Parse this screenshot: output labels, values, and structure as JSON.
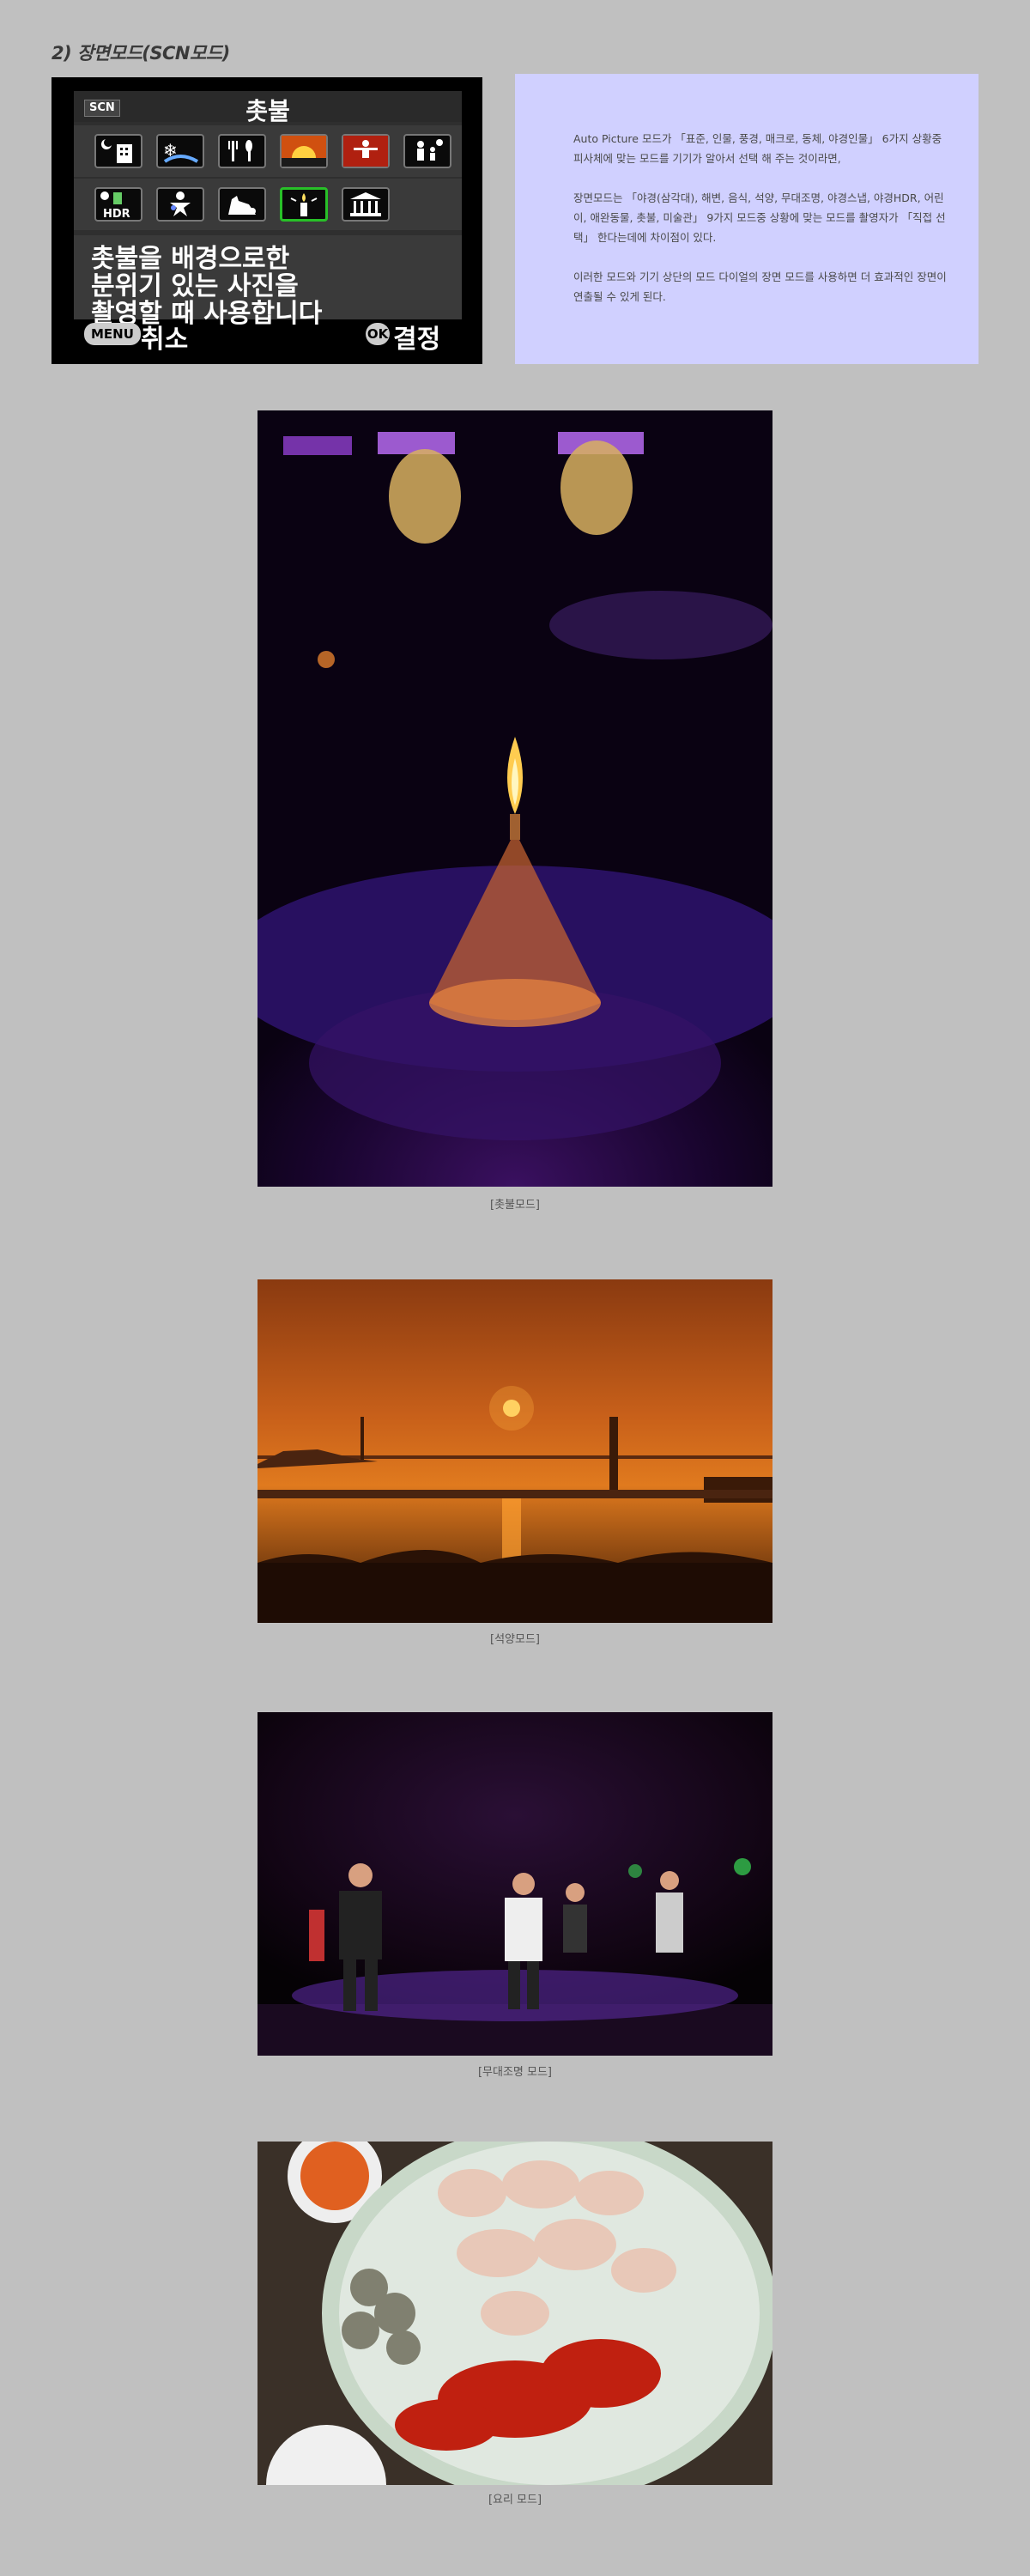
{
  "heading": "2) 장면모드(SCN모드)",
  "camera_screen": {
    "scn_badge": "SCN",
    "mode_title": "촛불",
    "row1_icons": [
      "night-portrait-icon",
      "snow-icon",
      "food-icon",
      "sunset-icon",
      "stage-icon",
      "child-icon"
    ],
    "row2_icons": [
      "night-hdr-icon",
      "kids-icon",
      "pet-icon",
      "candle-icon",
      "museum-icon"
    ],
    "hdr_label": "HDR",
    "selected_icon": "candle-icon",
    "description": "촛불을 배경으로한\n분위기 있는 사진을\n촬영할 때 사용합니다",
    "menu_button": "MENU",
    "cancel_label": "취소",
    "ok_button": "OK",
    "confirm_label": "결정"
  },
  "info": {
    "p1": "Auto Picture 모드가 「표준, 인물, 풍경, 매크로, 동체, 야경인물」 6가지 상황중 피사체에 맞는 모드를 기기가 알아서 선택 해 주는 것이라면,",
    "p2": "장면모드는 「야경(삼각대), 해변, 음식, 석양, 무대조명, 야경스냅, 야경HDR, 어린이, 애완동물, 촛불, 미술관」 9가지 모드중 상황에 맞는 모드를 촬영자가 「직접 선택」 한다는데에 차이점이 있다.",
    "p3": "이러한 모드와 기기 상단의 모드 다이얼의 장면 모드를 사용하면 더 효과적인 장면이 연출될 수 있게 된다."
  },
  "photos": [
    {
      "caption": "[촛불모드]",
      "subject": "candle-photo"
    },
    {
      "caption": "[석양모드]",
      "subject": "sunset-photo"
    },
    {
      "caption": "[무대조명 모드]",
      "subject": "stage-photo"
    },
    {
      "caption": "[요리 모드]",
      "subject": "food-photo"
    }
  ],
  "colors": {
    "page_bg": "#c0c0c0",
    "info_bg": "#d0d0ff",
    "selected_border": "#28c028"
  }
}
